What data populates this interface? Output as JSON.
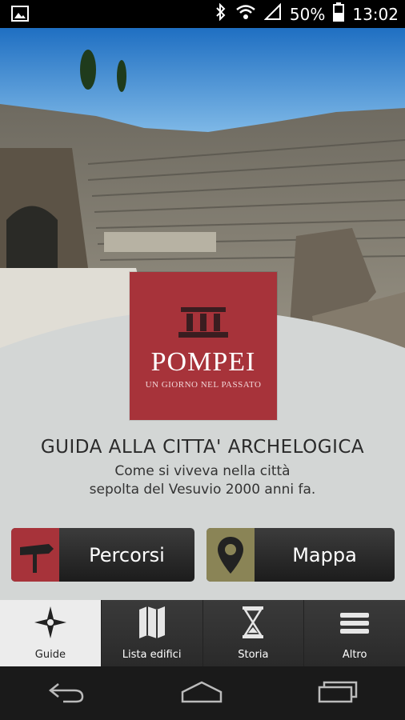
{
  "status_bar": {
    "battery": "50%",
    "time": "13:02",
    "icons": [
      "image-icon",
      "bluetooth-icon",
      "wifi-icon",
      "signal-icon",
      "battery-icon"
    ]
  },
  "logo": {
    "title": "POMPEI",
    "subtitle": "UN GIORNO NEL PASSATO"
  },
  "intro": {
    "headline": "GUIDA ALLA CITTA' ARCHELOGICA",
    "line1": "Come si viveva nella città",
    "line2": "sepolta del Vesuvio 2000 anni fa."
  },
  "actions": [
    {
      "label": "Percorsi",
      "icon": "signpost-icon",
      "color": "#a7333a"
    },
    {
      "label": "Mappa",
      "icon": "map-pin-icon",
      "color": "#8a8456"
    }
  ],
  "tabs": [
    {
      "label": "Guide",
      "icon": "compass-icon",
      "active": true
    },
    {
      "label": "Lista edifici",
      "icon": "map-icon",
      "active": false
    },
    {
      "label": "Storia",
      "icon": "hourglass-icon",
      "active": false
    },
    {
      "label": "Altro",
      "icon": "menu-icon",
      "active": false
    }
  ],
  "system_nav": [
    "back-icon",
    "home-icon",
    "recents-icon"
  ]
}
